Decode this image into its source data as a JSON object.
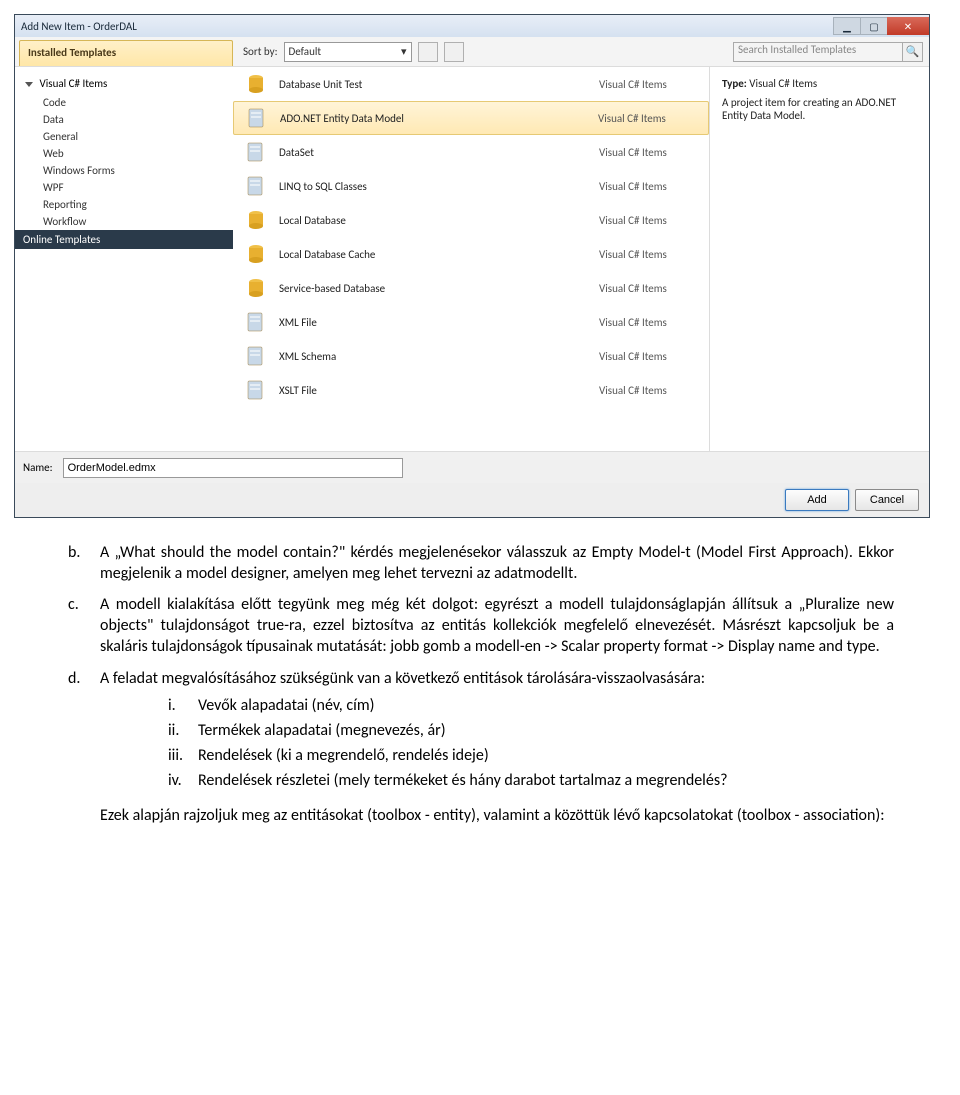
{
  "dialog": {
    "title": "Add New Item - OrderDAL",
    "installed_tab": "Installed Templates",
    "online_tab": "Online Templates",
    "sort_label": "Sort by:",
    "sort_value": "Default",
    "search_placeholder": "Search Installed Templates",
    "tree": {
      "root": "Visual C# Items",
      "children": [
        "Code",
        "Data",
        "General",
        "Web",
        "Windows Forms",
        "WPF",
        "Reporting",
        "Workflow"
      ]
    },
    "templates": [
      {
        "name": "Database Unit Test",
        "cat": "Visual C# Items"
      },
      {
        "name": "ADO.NET Entity Data Model",
        "cat": "Visual C# Items",
        "selected": true
      },
      {
        "name": "DataSet",
        "cat": "Visual C# Items"
      },
      {
        "name": "LINQ to SQL Classes",
        "cat": "Visual C# Items"
      },
      {
        "name": "Local Database",
        "cat": "Visual C# Items"
      },
      {
        "name": "Local Database Cache",
        "cat": "Visual C# Items"
      },
      {
        "name": "Service-based Database",
        "cat": "Visual C# Items"
      },
      {
        "name": "XML File",
        "cat": "Visual C# Items"
      },
      {
        "name": "XML Schema",
        "cat": "Visual C# Items"
      },
      {
        "name": "XSLT File",
        "cat": "Visual C# Items"
      }
    ],
    "info": {
      "type_label": "Type:",
      "type_value": "Visual C# Items",
      "desc": "A project item for creating an ADO.NET Entity Data Model."
    },
    "name_label": "Name:",
    "name_value": "OrderModel.edmx",
    "add_btn": "Add",
    "cancel_btn": "Cancel"
  },
  "doc": {
    "b_marker": "b.",
    "b_text": "A „What should the model contain?\" kérdés megjelenésekor válasszuk az Empty Model-t (Model First Approach). Ekkor megjelenik a model designer, amelyen meg lehet tervezni az adatmodellt.",
    "c_marker": "c.",
    "c_text": "A modell kialakítása előtt tegyünk meg még két dolgot: egyrészt a modell tulajdonságlapján állítsuk a „Pluralize new objects\" tulajdonságot true-ra, ezzel biztosítva az entitás kollekciók megfelelő elnevezését. Másrészt kapcsoljuk be a skaláris tulajdonságok típusainak mutatását: jobb gomb a modell-en -> Scalar property format -> Display name and type.",
    "d_marker": "d.",
    "d_intro": "A feladat megvalósításához szükségünk van a következő entitások tárolására-visszaolvasására:",
    "sub": [
      {
        "rm": "i.",
        "txt": "Vevők alapadatai (név, cím)"
      },
      {
        "rm": "ii.",
        "txt": "Termékek alapadatai (megnevezés, ár)"
      },
      {
        "rm": "iii.",
        "txt": "Rendelések (ki a megrendelő, rendelés ideje)"
      },
      {
        "rm": "iv.",
        "txt": "Rendelések részletei (mely termékeket és hány darabot tartalmaz a megrendelés?"
      }
    ],
    "para": "Ezek alapján rajzoljuk meg az entitásokat (toolbox - entity), valamint a közöttük lévő kapcsolatokat (toolbox - association):"
  }
}
